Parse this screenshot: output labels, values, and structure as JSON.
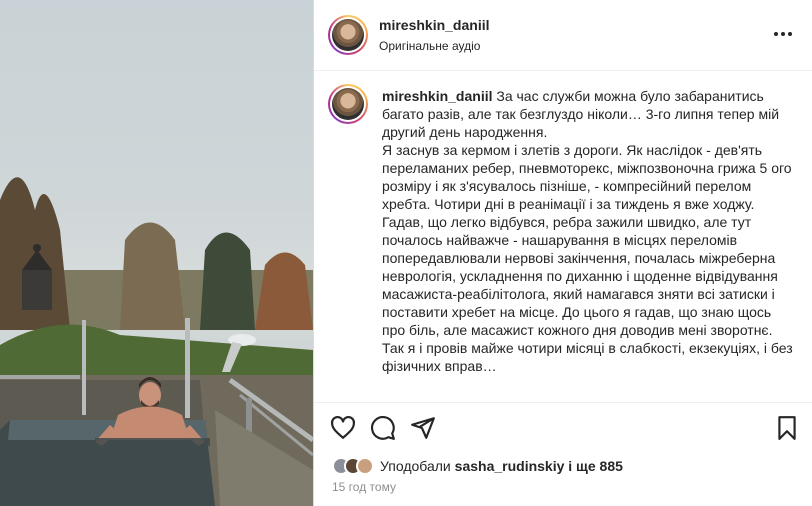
{
  "post": {
    "username": "mireshkin_daniil",
    "audio_label": "Оригінальне аудіо",
    "caption_user": "mireshkin_daniil",
    "caption_text": " За час служби можна було забаранитись багато разів, але так безглуздо ніколи… 3-го липня тепер мій другий день народження.\nЯ заснув за кермом і злетів з дороги. Як наслідок - дев'ять переламаних ребер, пневмоторекс, міжпозвоночна грижа 5 ого розміру і як з'ясувалось пізніше, - компресійний перелом хребта. Чотири дні в реанімації і за тиждень я вже ходжу. Гадав, що легко відбувся, ребра зажили швидко, але тут почалось найважче - нашарування в місцях переломів попередавлювали нервові закінчення, почалась міжреберна неврологія, ускладнення по диханню і щоденне відвідування масажиста-реабілітолога, який намагався зняти всі затиски і поставити хребет на місце. До цього я гадав, що знаю щось про біль, але масажист кожного дня доводив мені зворотнє. Так я і провів майже чотири місяці в слабкості, екзекуціях, і без фізичних вправ…",
    "likes_prefix": "Уподобали ",
    "likes_user": "sasha_rudinskiy",
    "likes_suffix": " і ще 885",
    "timestamp": "15 год тому"
  },
  "icons": {
    "more": "more-horizontal-icon",
    "like": "heart-icon",
    "comment": "comment-icon",
    "share": "send-icon",
    "save": "bookmark-icon"
  },
  "colors": {
    "text": "#262626",
    "muted": "#8e8e8e",
    "border": "#dbdbdb"
  }
}
